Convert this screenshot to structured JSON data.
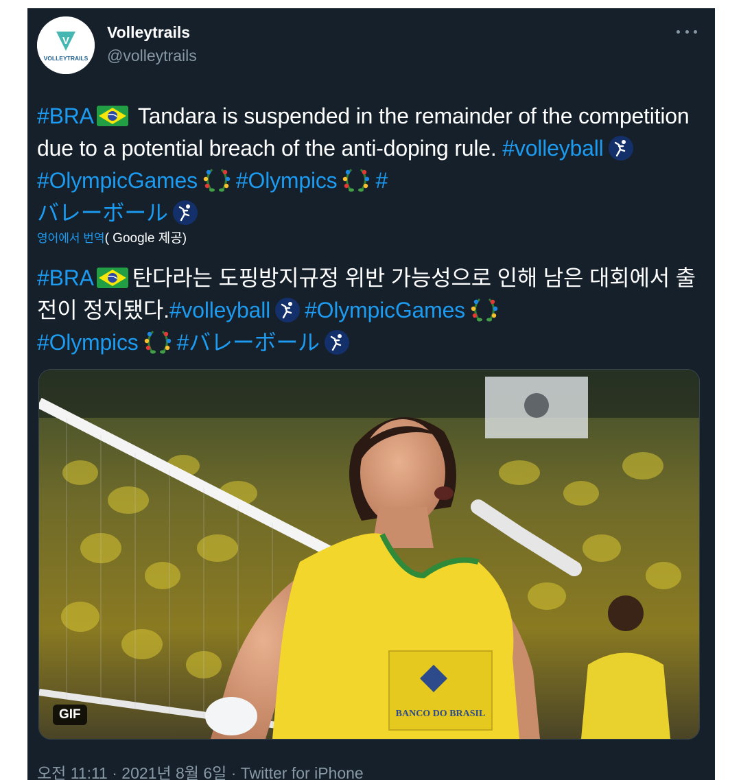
{
  "author": {
    "display_name": "Volleytrails",
    "handle": "@volleytrails",
    "avatar_logo_text": "VOLLEYTRAILS",
    "avatar_letter": "V"
  },
  "tweet": {
    "en": {
      "tag_bra": "#BRA",
      "body": " Tandara is suspended in the remainder of the competition due to a potential breach of the anti-doping rule. ",
      "tag_volleyball": "#volleyball",
      "tag_olympicgames": "#OlympicGames",
      "tag_olympics": "#Olympics",
      "tag_hash": "#",
      "tag_jp": "バレーボール"
    },
    "translation_label": "영어에서 번역",
    "translation_provider": "( Google 제공)",
    "ko": {
      "tag_bra": "#BRA",
      "body": "탄다라는 도핑방지규정 위반 가능성으로 인해 남은 대회에서 출전이 정지됐다.",
      "tag_volleyball": "#volleyball",
      "tag_olympicgames": "#OlympicGames",
      "tag_olympics": "#Olympics",
      "tag_jp": "#バレーボール"
    },
    "media_badge": "GIF",
    "media_bank_text": "BANCO DO BRASIL",
    "timestamp": "오전 11:11 · 2021년 8월 6일 · Twitter for iPhone"
  },
  "colors": {
    "background": "#15202b",
    "text": "#ffffff",
    "secondary": "#8899a6",
    "link": "#1d9bf0",
    "jersey": "#f2d62c"
  },
  "icons": [
    "more-options-icon",
    "brazil-flag-icon",
    "volleyball-icon",
    "olympic-wreath-icon"
  ]
}
